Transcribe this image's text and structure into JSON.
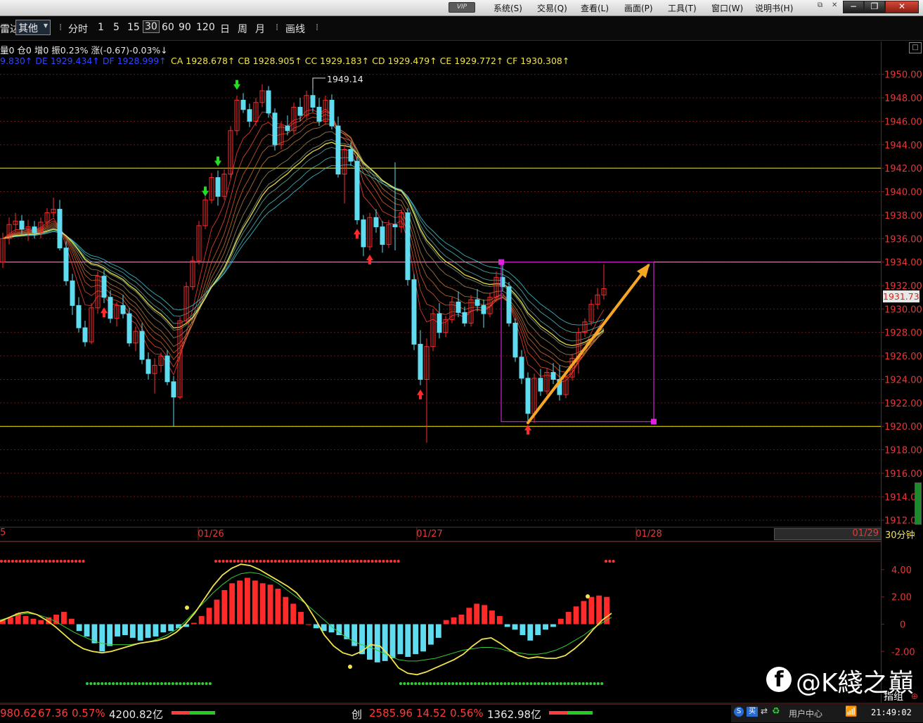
{
  "menu": {
    "vip": "VIP",
    "items": [
      "系统(S)",
      "交易(Q)",
      "查看(L)",
      "画面(P)",
      "工具(T)",
      "窗口(W)",
      "说明书(H)"
    ]
  },
  "toolbar": {
    "prefix": "雷达",
    "dropdown": "其他",
    "periods": [
      "分时",
      "1",
      "5",
      "15",
      "30",
      "60",
      "90",
      "120",
      "日",
      "周",
      "月"
    ],
    "selected_period": "30",
    "draw_label": "画线"
  },
  "indicators": {
    "line1": "量0  仓0  增0 振0.23%  涨(-0.67)-0.03%↓",
    "line2_blue": "9.830↑  DE 1929.434↑  DF 1928.999↑",
    "line2_yellow": "CA 1928.678↑  CB 1928.905↑  CC 1929.183↑  CD 1929.479↑  CE 1929.772↑  CF 1930.308↑"
  },
  "colors": {
    "up": "#ff2a2a",
    "down": "#5fdcf0",
    "axis_text": "#e23a3a",
    "hline": "#f0f000",
    "box": "#c020c0",
    "arrow": "#f5a623"
  },
  "price_tag": "1931.73",
  "period_label": "30分钟",
  "scroll_label": "01/29",
  "status": {
    "left_price": "980.62",
    "left_change": "67.36",
    "left_pct": "0.57%",
    "left_amount": "4200.82亿",
    "mid_name": "创",
    "mid_price": "2585.96",
    "mid_change": "14.52",
    "mid_pct": "0.56%",
    "mid_amount": "1362.98亿",
    "user_center": "用户中心",
    "time": "21:49:02",
    "bottom_right": "指组"
  },
  "watermark": "@K綫之巔",
  "chart_data": [
    {
      "type": "candlestick",
      "ylabel": "",
      "ylim": [
        1911.5,
        1952.5
      ],
      "yticks": [
        "1950.00",
        "1948.00",
        "1946.00",
        "1944.00",
        "1942.00",
        "1940.00",
        "1938.00",
        "1936.00",
        "1934.00",
        "1932.00",
        "1930.00",
        "1928.00",
        "1926.00",
        "1924.00",
        "1922.00",
        "1920.00",
        "1918.00",
        "1916.00",
        "1914.00",
        "1912.00"
      ],
      "xticks": [
        "01/26",
        "01/27",
        "01/28"
      ],
      "high_annotation": "1949.14",
      "horizontal_lines": [
        1942.0,
        1920.0,
        1934.0
      ],
      "box": {
        "y_top": 1934.0,
        "y_bottom": 1920.4
      },
      "trend_arrow": {
        "from": 1920.3,
        "to": 1933.7
      },
      "candles": [
        [
          1934,
          1936.5,
          1933.5,
          1936
        ],
        [
          1936,
          1937.8,
          1935.5,
          1937.2
        ],
        [
          1937.2,
          1938.2,
          1936.6,
          1937.5
        ],
        [
          1937.5,
          1938,
          1936.4,
          1936.8
        ],
        [
          1936.8,
          1937.6,
          1935.8,
          1937
        ],
        [
          1937,
          1937.5,
          1936,
          1936.5
        ],
        [
          1936.5,
          1937.8,
          1936,
          1937.4
        ],
        [
          1937.4,
          1938.6,
          1937,
          1938.2
        ],
        [
          1938.2,
          1939.5,
          1937.8,
          1938.5
        ],
        [
          1938.5,
          1939.3,
          1935,
          1935.2
        ],
        [
          1935.2,
          1935.8,
          1932,
          1932.4
        ],
        [
          1932.4,
          1933,
          1929.5,
          1930.3
        ],
        [
          1930.3,
          1931,
          1928,
          1928.4
        ],
        [
          1928.4,
          1929,
          1926.8,
          1927.2
        ],
        [
          1927.2,
          1930.5,
          1927,
          1930.1
        ],
        [
          1930.1,
          1933.2,
          1929.6,
          1932.8
        ],
        [
          1932.8,
          1933.3,
          1930.5,
          1931
        ],
        [
          1931,
          1931.6,
          1928.8,
          1929.2
        ],
        [
          1929.2,
          1930.6,
          1928.5,
          1930.3
        ],
        [
          1930.3,
          1931.2,
          1929.2,
          1929.6
        ],
        [
          1929.6,
          1930.1,
          1926.8,
          1927.1
        ],
        [
          1927.1,
          1928.5,
          1926.4,
          1928.1
        ],
        [
          1928.1,
          1928.8,
          1925.3,
          1925.7
        ],
        [
          1925.7,
          1926.3,
          1924,
          1924.5
        ],
        [
          1924.5,
          1925.8,
          1922.8,
          1925.2
        ],
        [
          1925.2,
          1926.3,
          1924.6,
          1926
        ],
        [
          1926,
          1926.5,
          1923.5,
          1923.8
        ],
        [
          1923.8,
          1924.3,
          1920,
          1922.5
        ],
        [
          1922.5,
          1929.3,
          1922.3,
          1929
        ],
        [
          1929,
          1932.3,
          1928.8,
          1931.9
        ],
        [
          1931.9,
          1934.5,
          1931.6,
          1934.1
        ],
        [
          1934.1,
          1937.5,
          1933.8,
          1937.1
        ],
        [
          1937.1,
          1939.6,
          1936.8,
          1939.3
        ],
        [
          1939.3,
          1941.6,
          1939,
          1941.2
        ],
        [
          1941.2,
          1941.8,
          1938.8,
          1939.6
        ],
        [
          1939.6,
          1941.9,
          1939.3,
          1941.5
        ],
        [
          1941.5,
          1945.6,
          1941.2,
          1945.2
        ],
        [
          1945.2,
          1948.2,
          1944.8,
          1947.8
        ],
        [
          1947.8,
          1948.4,
          1946.7,
          1947
        ],
        [
          1947,
          1947.5,
          1945.5,
          1946
        ],
        [
          1946,
          1948,
          1945.6,
          1947.6
        ],
        [
          1947.6,
          1949.14,
          1947.2,
          1948.6
        ],
        [
          1948.6,
          1949,
          1946.3,
          1946.7
        ],
        [
          1946.7,
          1947.1,
          1943.5,
          1944
        ],
        [
          1944,
          1946,
          1943.6,
          1945.6
        ],
        [
          1945.6,
          1946.5,
          1944.8,
          1945.2
        ],
        [
          1945.2,
          1947.6,
          1944.9,
          1947.2
        ],
        [
          1947.2,
          1948,
          1946,
          1946.5
        ],
        [
          1946.5,
          1948.6,
          1946.2,
          1948.2
        ],
        [
          1948.2,
          1949.2,
          1946.8,
          1947.2
        ],
        [
          1947.2,
          1948,
          1945.6,
          1946
        ],
        [
          1946,
          1948.2,
          1945.7,
          1947.8
        ],
        [
          1947.8,
          1948.3,
          1945.3,
          1945.6
        ],
        [
          1945.6,
          1946.4,
          1941.2,
          1941.5
        ],
        [
          1941.5,
          1944,
          1939,
          1943.6
        ],
        [
          1943.6,
          1944.2,
          1942.2,
          1942.6
        ],
        [
          1942.6,
          1943,
          1937.2,
          1937.6
        ],
        [
          1937.6,
          1938,
          1934.5,
          1935.3
        ],
        [
          1935.3,
          1938.2,
          1935,
          1937.8
        ],
        [
          1937.8,
          1938.5,
          1936.5,
          1937
        ],
        [
          1937,
          1937.5,
          1934.8,
          1935.5
        ],
        [
          1935.5,
          1937.6,
          1935.2,
          1937.2
        ],
        [
          1937.2,
          1942.5,
          1935,
          1937
        ],
        [
          1937,
          1938.5,
          1936.5,
          1938.2
        ],
        [
          1938.2,
          1938.6,
          1932,
          1932.5
        ],
        [
          1932.5,
          1933,
          1926.5,
          1927
        ],
        [
          1927,
          1928.2,
          1923.5,
          1924
        ],
        [
          1924,
          1927.5,
          1918.6,
          1926.8
        ],
        [
          1926.8,
          1930,
          1926.4,
          1929.6
        ],
        [
          1929.6,
          1930.5,
          1927.5,
          1928
        ],
        [
          1928,
          1929.4,
          1927.6,
          1929.1
        ],
        [
          1929.1,
          1931,
          1928.8,
          1930.6
        ],
        [
          1930.6,
          1931.5,
          1929.3,
          1929.7
        ],
        [
          1929.7,
          1930.2,
          1928.5,
          1928.8
        ],
        [
          1928.8,
          1931.2,
          1928.5,
          1930.8
        ],
        [
          1930.8,
          1931.7,
          1929.8,
          1930.3
        ],
        [
          1930.3,
          1930.8,
          1928.4,
          1929.6
        ],
        [
          1929.6,
          1931.4,
          1929.3,
          1931
        ],
        [
          1931,
          1933.2,
          1930.6,
          1932.7
        ],
        [
          1932.7,
          1934.2,
          1931.5,
          1931.9
        ],
        [
          1931.9,
          1932.3,
          1928.5,
          1928.8
        ],
        [
          1928.8,
          1929.2,
          1925.5,
          1925.9
        ],
        [
          1925.9,
          1926.5,
          1923.6,
          1924.1
        ],
        [
          1924.1,
          1924.6,
          1920.5,
          1921.1
        ],
        [
          1921.1,
          1924.5,
          1920.3,
          1924.1
        ],
        [
          1924.1,
          1924.9,
          1922.6,
          1923
        ],
        [
          1923,
          1925,
          1922.7,
          1924.6
        ],
        [
          1924.6,
          1925.4,
          1923.6,
          1924
        ],
        [
          1924,
          1925.2,
          1922.2,
          1922.7
        ],
        [
          1922.7,
          1924.5,
          1922.4,
          1924.2
        ],
        [
          1924.2,
          1926.2,
          1923.9,
          1925.8
        ],
        [
          1925.8,
          1928.4,
          1924.5,
          1928
        ],
        [
          1928,
          1929.2,
          1927.6,
          1928.9
        ],
        [
          1928.9,
          1930.8,
          1928.6,
          1930.4
        ],
        [
          1930.4,
          1931.8,
          1930,
          1931.2
        ],
        [
          1931.2,
          1933.8,
          1930.8,
          1931.73
        ]
      ]
    },
    {
      "type": "macd",
      "ylim": [
        -5.8,
        5.8
      ],
      "yticks": [
        "4.00",
        "2.00",
        "0",
        "-2.00"
      ],
      "hist": [
        0.3,
        0.5,
        0.8,
        0.6,
        0.4,
        0.3,
        0.5,
        0.7,
        0.9,
        0.4,
        -0.5,
        -0.9,
        -1.4,
        -2,
        -1.6,
        -0.9,
        -0.8,
        -1,
        -1.2,
        -1,
        -0.9,
        -0.6,
        -0.5,
        -0.3,
        -0.2,
        0.1,
        0.6,
        1.2,
        1.8,
        2.5,
        3,
        3.2,
        3.4,
        3.2,
        3,
        2.9,
        2.6,
        2,
        1.5,
        0.9,
        0,
        -0.3,
        -0.5,
        -0.6,
        -0.8,
        -1.1,
        -1.6,
        -2.2,
        -2.6,
        -2.8,
        -2.7,
        -2.5,
        -2.2,
        -2.4,
        -2.2,
        -2,
        -1.5,
        -1,
        0.3,
        0.5,
        0.7,
        1.2,
        1.5,
        1.4,
        1,
        0.6,
        -0.2,
        -0.4,
        -0.8,
        -1.2,
        -0.8,
        -0.4,
        -0.2,
        0.4,
        0.9,
        1.3,
        1.7,
        2,
        2.1,
        2
      ],
      "dif": [
        0.2,
        0.5,
        0.8,
        0.9,
        0.7,
        0.3,
        -0.2,
        -0.8,
        -1.4,
        -1.8,
        -2,
        -2.1,
        -2,
        -1.8,
        -1.6,
        -1.4,
        -1.3,
        -1.2,
        -1,
        -0.6,
        0,
        0.8,
        1.8,
        2.8,
        3.6,
        4.1,
        4.4,
        4.3,
        4,
        3.6,
        3.2,
        2.8,
        2.3,
        1.5,
        0.4,
        -0.8,
        -1.6,
        -2.1,
        -2.3,
        -2,
        -1.5,
        -1.6,
        -2.3,
        -3.2,
        -3.6,
        -3.7,
        -3.5,
        -3.2,
        -2.9,
        -2.6,
        -2.2,
        -1.6,
        -1.1,
        -1,
        -1.4,
        -1.9,
        -2.3,
        -2.5,
        -2.4,
        -2.5,
        -2.5,
        -2.3,
        -1.8,
        -1.2,
        -0.4,
        0.3,
        0.8
      ],
      "dea": [
        0.3,
        0.5,
        0.7,
        0.8,
        0.7,
        0.5,
        0.2,
        -0.2,
        -0.6,
        -0.9,
        -1.2,
        -1.4,
        -1.5,
        -1.5,
        -1.5,
        -1.4,
        -1.3,
        -1.1,
        -0.8,
        -0.4,
        0.2,
        0.9,
        1.6,
        2.3,
        2.9,
        3.4,
        3.7,
        3.8,
        3.7,
        3.4,
        3,
        2.5,
        2,
        1.5,
        0.9,
        0.3,
        -0.3,
        -0.8,
        -1.2,
        -1.5,
        -1.7,
        -2,
        -2.3,
        -2.6,
        -2.7,
        -2.7,
        -2.6,
        -2.5,
        -2.3,
        -2.1,
        -1.9,
        -1.8,
        -1.7,
        -1.7,
        -1.8,
        -2,
        -2.1,
        -2.2,
        -2.2,
        -2.1,
        -1.9,
        -1.6,
        -1.2,
        -0.8,
        -0.3,
        0.1,
        0.5
      ]
    }
  ]
}
